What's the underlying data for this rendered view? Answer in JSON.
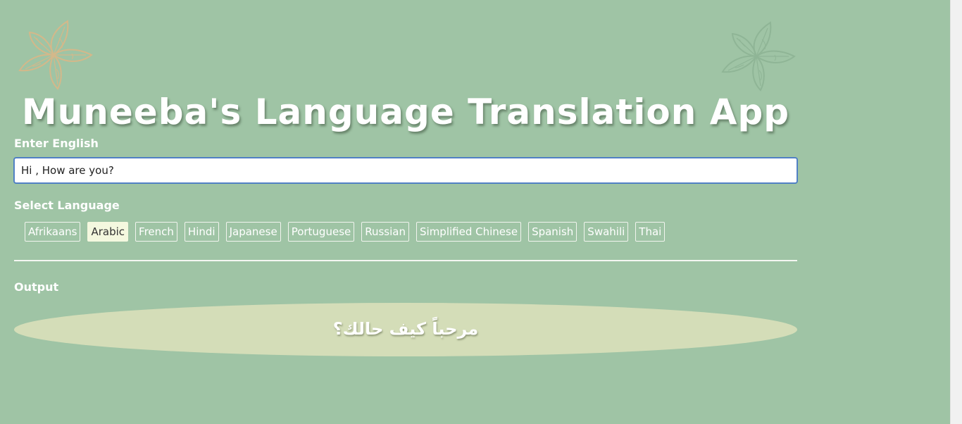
{
  "header": {
    "title": "Muneeba's Language Translation App"
  },
  "input_section": {
    "label": "Enter English",
    "value": "Hi , How are you?"
  },
  "language_section": {
    "label": "Select Language",
    "languages": [
      {
        "label": "Afrikaans",
        "active": false
      },
      {
        "label": "Arabic",
        "active": true
      },
      {
        "label": "French",
        "active": false
      },
      {
        "label": "Hindi",
        "active": false
      },
      {
        "label": "Japanese",
        "active": false
      },
      {
        "label": "Portuguese",
        "active": false
      },
      {
        "label": "Russian",
        "active": false
      },
      {
        "label": "Simplified Chinese",
        "active": false
      },
      {
        "label": "Spanish",
        "active": false
      },
      {
        "label": "Swahili",
        "active": false
      },
      {
        "label": "Thai",
        "active": false
      }
    ]
  },
  "output_section": {
    "label": "Output",
    "text": "مرحباً كيف حالك؟"
  },
  "colors": {
    "background": "#9fc4a5",
    "output_bg": "#d4ddb8",
    "active_button_bg": "#f4f8df",
    "flower_left": "#d4b88a",
    "flower_right": "#8fb596"
  },
  "icons": {
    "left_decoration": "flower-icon",
    "right_decoration": "flower-icon"
  }
}
